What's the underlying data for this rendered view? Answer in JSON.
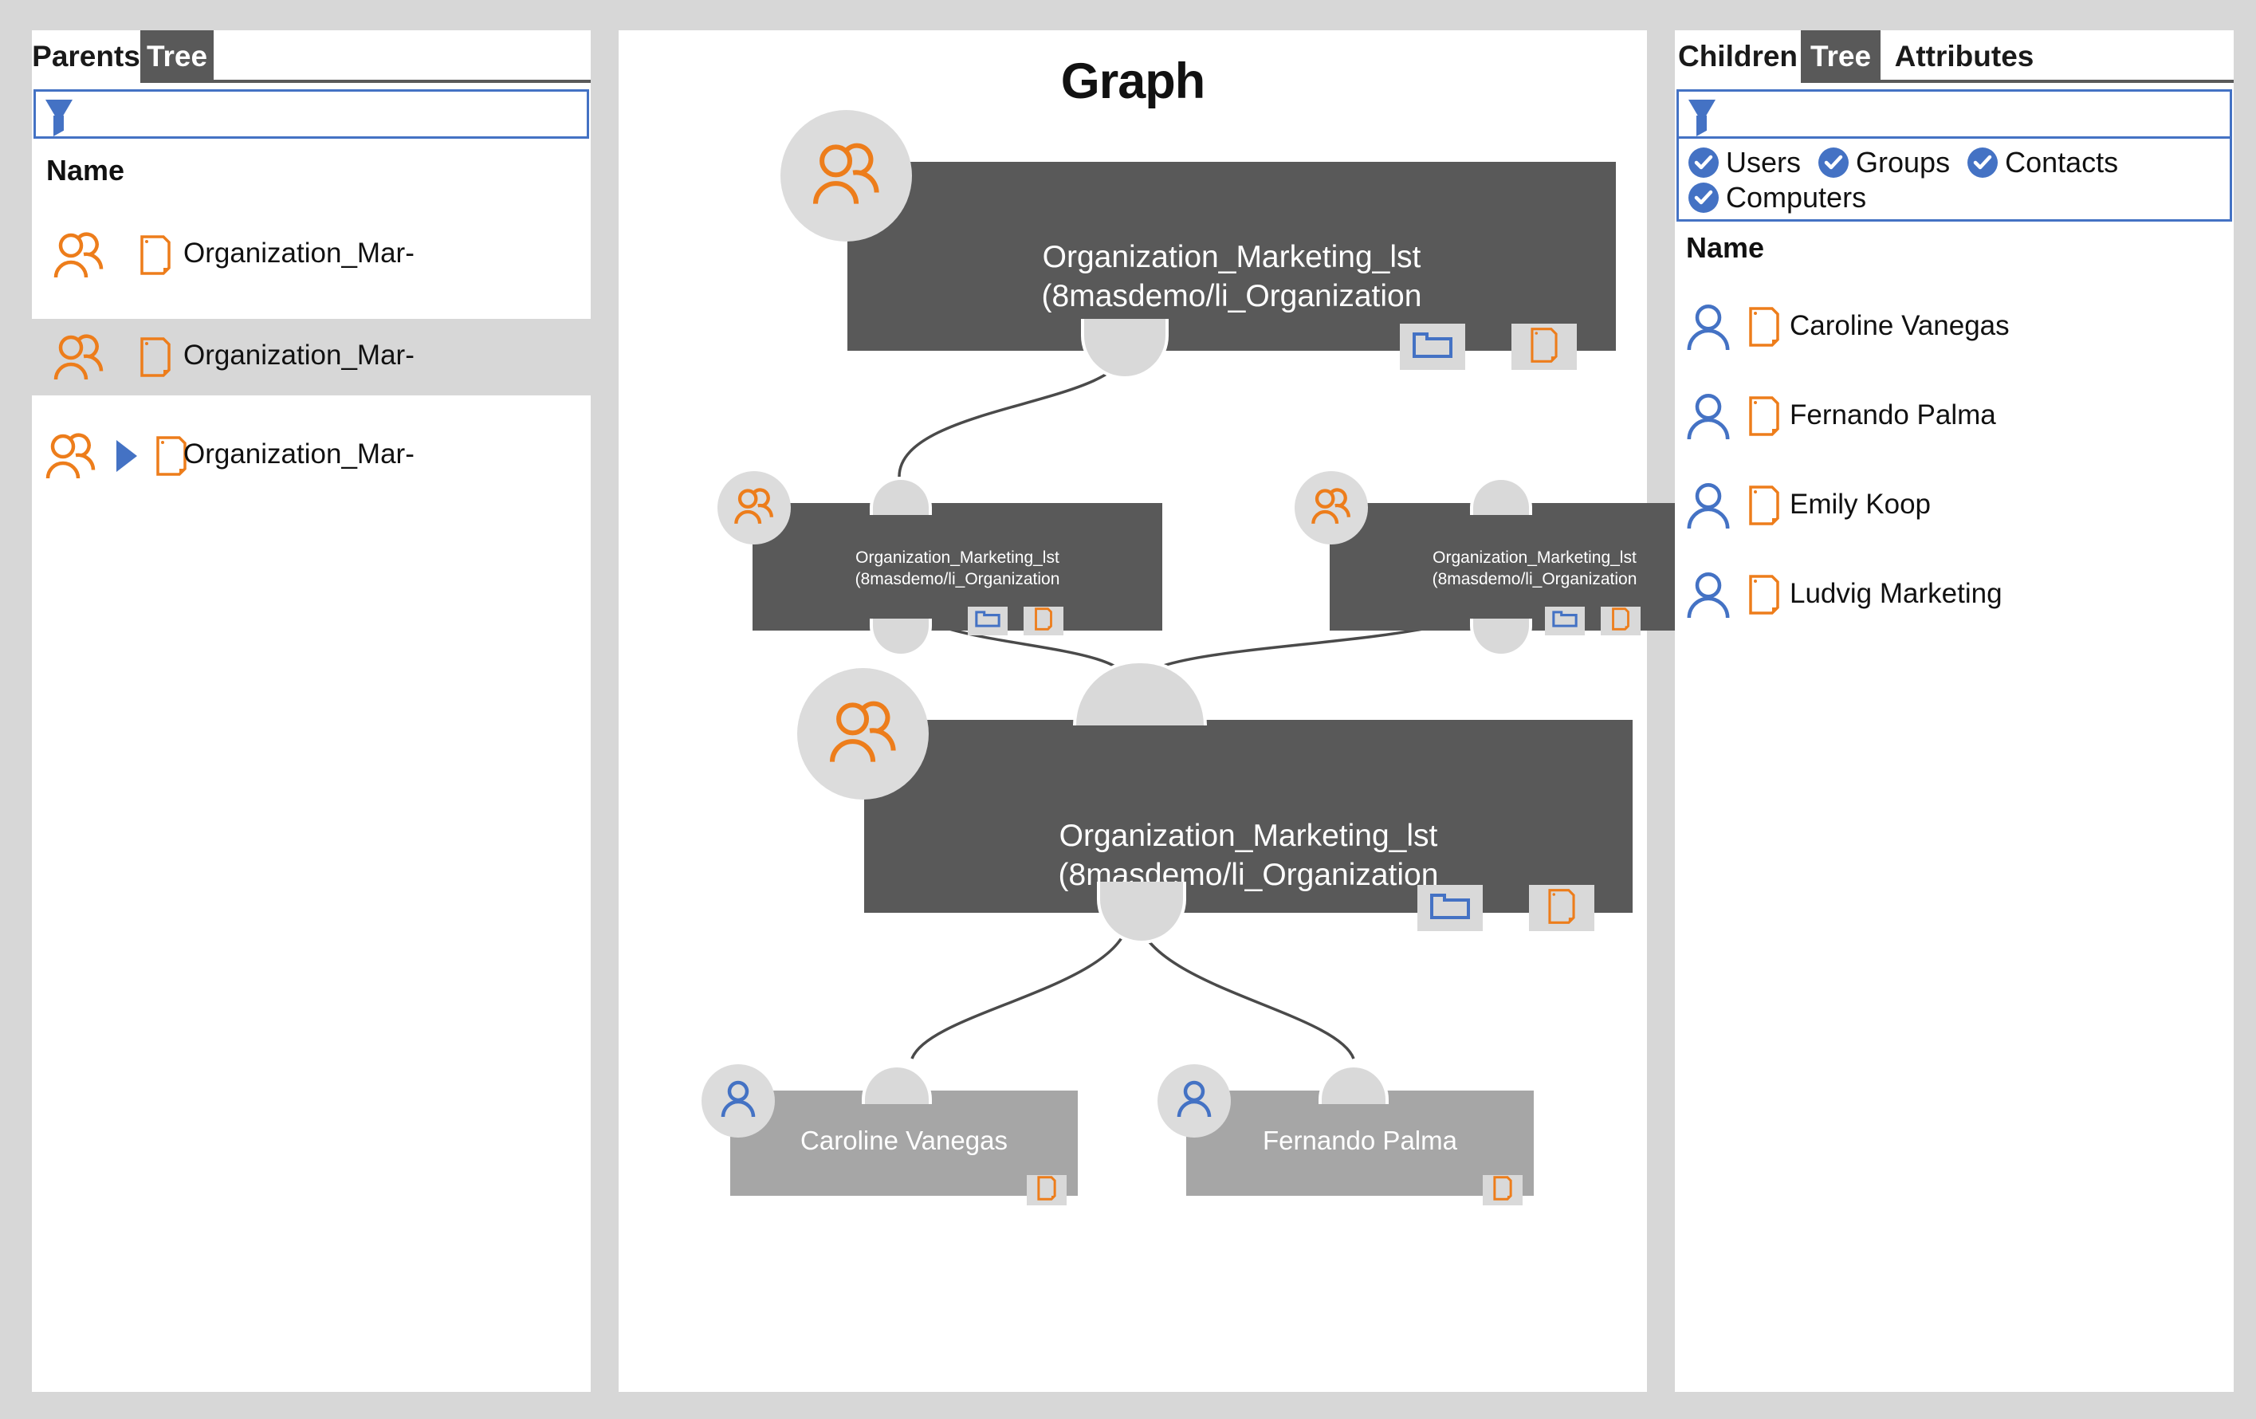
{
  "theme": {
    "page_bg": "#d7d7d7",
    "panel_bg": "#ffffff",
    "tab_active_bg": "#595959",
    "accent_blue": "#4472c4",
    "accent_orange": "#ed7d1b",
    "group_node_bg": "#595959",
    "user_node_bg": "#a6a6a6",
    "connector_gray": "#d9d9d9"
  },
  "left_panel": {
    "tabs": [
      {
        "label": "Parents",
        "active": false
      },
      {
        "label": "Tree",
        "active": true
      }
    ],
    "filter": {
      "value": "",
      "placeholder": "",
      "icon": "filter-funnel-icon"
    },
    "column_header": "Name",
    "rows": [
      {
        "label": "Organization_Mar-",
        "icon": "group-icon",
        "doc_icon": "document-icon",
        "expander": false,
        "selected": false
      },
      {
        "label": "Organization_Mar-",
        "icon": "group-icon",
        "doc_icon": "document-icon",
        "expander": false,
        "selected": true
      },
      {
        "label": "Organization_Mar-",
        "icon": "group-icon",
        "doc_icon": "document-icon",
        "expander": true,
        "selected": false
      }
    ]
  },
  "graph_panel": {
    "title": "Graph",
    "nodes": [
      {
        "id": "root",
        "type": "group",
        "line1": "Organization_Marketing_lst",
        "line2": "(8masdemo/li_Organization",
        "badges": [
          "folder-icon",
          "document-icon"
        ],
        "avatar_icon": "group-icon"
      },
      {
        "id": "mid-left",
        "type": "group",
        "line1": "Organization_Marketing_lst",
        "line2": "(8masdemo/li_Organization",
        "badges": [
          "folder-icon",
          "document-icon"
        ],
        "avatar_icon": "group-icon"
      },
      {
        "id": "mid-right",
        "type": "group",
        "line1": "Organization_Marketing_lst",
        "line2": "(8masdemo/li_Organization",
        "badges": [
          "folder-icon",
          "document-icon"
        ],
        "avatar_icon": "group-icon"
      },
      {
        "id": "center",
        "type": "group",
        "line1": "Organization_Marketing_lst",
        "line2": "(8masdemo/li_Organization",
        "badges": [
          "folder-icon",
          "document-icon"
        ],
        "avatar_icon": "group-icon"
      },
      {
        "id": "leaf-left",
        "type": "user",
        "line1": "Caroline Vanegas",
        "line2": "",
        "badges": [
          "document-icon"
        ],
        "avatar_icon": "user-icon"
      },
      {
        "id": "leaf-right",
        "type": "user",
        "line1": "Fernando Palma",
        "line2": "",
        "badges": [
          "document-icon"
        ],
        "avatar_icon": "user-icon"
      }
    ]
  },
  "right_panel": {
    "tabs": [
      {
        "label": "Children",
        "active": false
      },
      {
        "label": "Tree",
        "active": true
      },
      {
        "label": "Attributes",
        "active": false
      }
    ],
    "filter": {
      "value": "",
      "placeholder": "",
      "icon": "filter-funnel-icon"
    },
    "type_filters": [
      {
        "label": "Users",
        "checked": true
      },
      {
        "label": "Groups",
        "checked": true
      },
      {
        "label": "Contacts",
        "checked": true
      },
      {
        "label": "Computers",
        "checked": true
      }
    ],
    "column_header": "Name",
    "rows": [
      {
        "label": "Caroline Vanegas",
        "icon": "user-icon",
        "doc_icon": "document-icon"
      },
      {
        "label": "Fernando Palma",
        "icon": "user-icon",
        "doc_icon": "document-icon"
      },
      {
        "label": "Emily Koop",
        "icon": "user-icon",
        "doc_icon": "document-icon"
      },
      {
        "label": "Ludvig Marketing",
        "icon": "user-icon",
        "doc_icon": "document-icon"
      }
    ]
  }
}
